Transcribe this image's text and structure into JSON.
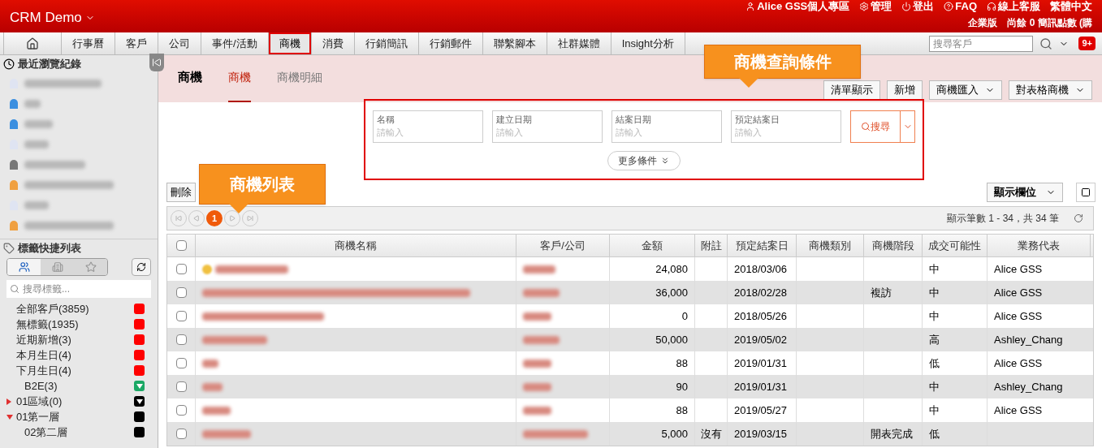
{
  "header": {
    "brand": "CRM Demo",
    "top_links": [
      {
        "kind": "user",
        "label": "Alice GSS個人專區"
      },
      {
        "kind": "gear",
        "label": "管理"
      },
      {
        "kind": "power",
        "label": "登出"
      },
      {
        "kind": "help",
        "label": "FAQ"
      },
      {
        "kind": "headset",
        "label": "線上客服"
      },
      {
        "kind": "plain",
        "label": "繁體中文"
      }
    ],
    "account_line": [
      "企業版",
      "尚餘 0 簡訊點數 (購"
    ]
  },
  "nav": {
    "tabs": [
      {
        "kind": "home",
        "selected": false,
        "highlighted": false
      },
      {
        "kind": "text",
        "label": "行事曆",
        "selected": false,
        "highlighted": false
      },
      {
        "kind": "text",
        "label": "客戶",
        "selected": false,
        "highlighted": false
      },
      {
        "kind": "text",
        "label": "公司",
        "selected": false,
        "highlighted": false
      },
      {
        "kind": "text",
        "label": "事件/活動",
        "selected": false,
        "highlighted": false
      },
      {
        "kind": "text",
        "label": "商機",
        "selected": true,
        "highlighted": true
      },
      {
        "kind": "text",
        "label": "消費",
        "selected": false,
        "highlighted": false
      },
      {
        "kind": "text",
        "label": "行銷簡訊",
        "selected": false,
        "highlighted": false
      },
      {
        "kind": "text",
        "label": "行銷郵件",
        "selected": false,
        "highlighted": false
      },
      {
        "kind": "text",
        "label": "聯繫腳本",
        "selected": false,
        "highlighted": false
      },
      {
        "kind": "text",
        "label": "社群媒體",
        "selected": false,
        "highlighted": false
      },
      {
        "kind": "text",
        "label": "Insight分析",
        "selected": false,
        "highlighted": false
      }
    ],
    "search_placeholder": "搜尋客戶",
    "badge": "9+"
  },
  "sidebar": {
    "recent_title": "最近瀏覽紀錄",
    "recent_items": [
      {
        "color": "#dfe4f2"
      },
      {
        "color": "#3b8fe0"
      },
      {
        "color": "#3b8fe0"
      },
      {
        "color": "#dfe4f2"
      },
      {
        "color": "#777777"
      },
      {
        "color": "#f0a040"
      },
      {
        "color": "#dfe4f2"
      },
      {
        "color": "#f0a040"
      }
    ],
    "tags_title": "標籤快捷列表",
    "tag_filters": [
      {
        "kind": "people",
        "selected": true
      },
      {
        "kind": "company",
        "selected": false
      },
      {
        "kind": "star",
        "selected": false
      }
    ],
    "tag_search_placeholder": "搜尋標籤...",
    "tags": [
      {
        "label": "全部客戶(3859)",
        "color": "#ff0000",
        "kind": "square"
      },
      {
        "label": "無標籤(1935)",
        "color": "#ff0000",
        "kind": "square"
      },
      {
        "label": "近期新增(3)",
        "color": "#ff0000",
        "kind": "square"
      },
      {
        "label": "本月生日(4)",
        "color": "#ff0000",
        "kind": "square"
      },
      {
        "label": "下月生日(4)",
        "color": "#ff0000",
        "kind": "square",
        "children": [
          {
            "label": "B2E(3)",
            "color": "#1aa865",
            "kind": "triangle"
          }
        ]
      },
      {
        "label": "01區域(0)",
        "color": "#000000",
        "kind": "triangle",
        "expanded": false
      },
      {
        "label": "01第一層",
        "color": "#000000",
        "kind": "square",
        "expanded": true,
        "children": [
          {
            "label": "02第二層",
            "color": "#000000",
            "kind": "square"
          }
        ]
      }
    ]
  },
  "main": {
    "title": "商機",
    "subtabs": [
      {
        "label": "商機",
        "selected": true
      },
      {
        "label": "商機明細",
        "selected": false
      }
    ],
    "actions": [
      {
        "label": "清單顯示",
        "dropdown": false
      },
      {
        "label": "新增",
        "dropdown": false
      },
      {
        "label": "商機匯入",
        "dropdown": true
      },
      {
        "label": "對表格商機",
        "dropdown": true
      }
    ],
    "search_fields": [
      {
        "label": "名稱",
        "placeholder": "請輸入"
      },
      {
        "label": "建立日期",
        "placeholder": "請輸入"
      },
      {
        "label": "結案日期",
        "placeholder": "請輸入"
      },
      {
        "label": "預定結案日",
        "placeholder": "請輸入"
      }
    ],
    "search_button": "搜尋",
    "more_button": "更多條件",
    "annotations": [
      {
        "text": "商機查詢條件"
      },
      {
        "text": "商機列表"
      }
    ],
    "delete_button": "刪除",
    "columns_button": "顯示欄位",
    "pages": [
      {
        "label": "1",
        "selected": true
      }
    ],
    "summary": "顯示筆數 1 - 34，共 34 筆",
    "all_checked": false,
    "columns": [
      "商機名稱",
      "客戶/公司",
      "金額",
      "附註",
      "預定結案日",
      "商機類別",
      "商機階段",
      "成交可能性",
      "業務代表"
    ],
    "rows": [
      {
        "checked": false,
        "has_icon": true,
        "amount": "24,080",
        "close_date": "2018/03/06",
        "probability": "中",
        "rep": "Alice GSS"
      },
      {
        "checked": false,
        "has_icon": false,
        "amount": "36,000",
        "close_date": "2018/02/28",
        "stage": "複訪",
        "probability": "中",
        "rep": "Alice GSS"
      },
      {
        "checked": false,
        "has_icon": false,
        "amount": "0",
        "close_date": "2018/05/26",
        "probability": "中",
        "rep": "Alice GSS"
      },
      {
        "checked": false,
        "has_icon": false,
        "amount": "50,000",
        "close_date": "2019/05/02",
        "probability": "高",
        "rep": "Ashley_Chang"
      },
      {
        "checked": false,
        "has_icon": false,
        "amount": "88",
        "close_date": "2019/01/31",
        "probability": "低",
        "rep": "Alice GSS"
      },
      {
        "checked": false,
        "has_icon": false,
        "amount": "90",
        "close_date": "2019/01/31",
        "probability": "中",
        "rep": "Ashley_Chang"
      },
      {
        "checked": false,
        "has_icon": false,
        "amount": "88",
        "close_date": "2019/05/27",
        "probability": "中",
        "rep": "Alice GSS"
      },
      {
        "checked": false,
        "has_icon": false,
        "amount": "5,000",
        "note": "沒有",
        "close_date": "2019/03/15",
        "stage": "開表完成",
        "probability": "低"
      }
    ]
  }
}
